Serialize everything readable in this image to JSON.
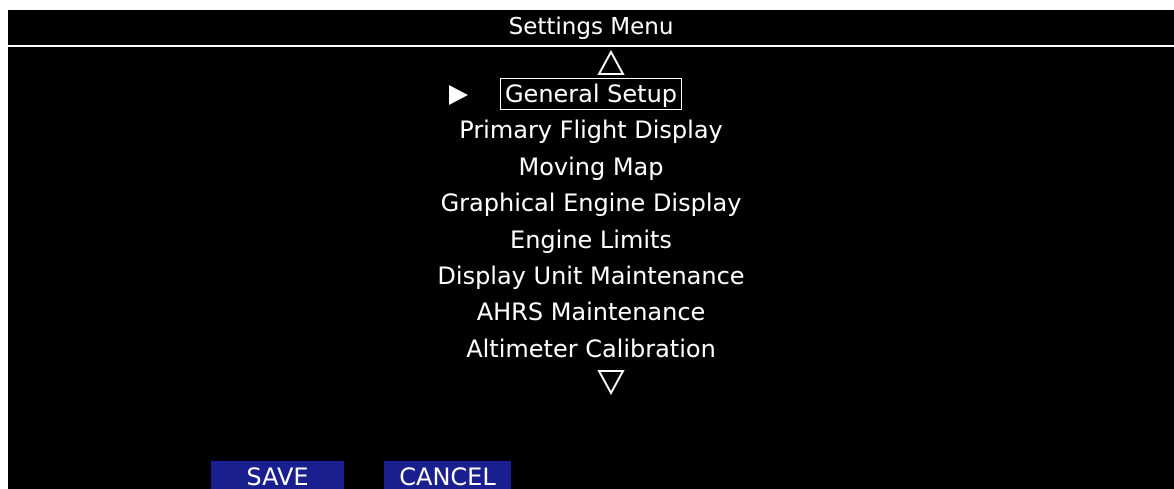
{
  "header": {
    "title": "Settings Menu"
  },
  "menu": {
    "selected_index": 0,
    "items": [
      {
        "label": "General Setup"
      },
      {
        "label": "Primary Flight Display"
      },
      {
        "label": "Moving Map"
      },
      {
        "label": "Graphical Engine Display"
      },
      {
        "label": "Engine Limits"
      },
      {
        "label": "Display Unit Maintenance"
      },
      {
        "label": "AHRS Maintenance"
      },
      {
        "label": "Altimeter Calibration"
      }
    ]
  },
  "icons": {
    "scroll_up": "triangle-up-outline-icon",
    "scroll_down": "triangle-down-outline-icon",
    "selector": "triangle-right-filled-icon"
  },
  "softkeys": {
    "save_label": "SAVE",
    "cancel_label": "CANCEL"
  },
  "colors": {
    "background": "#000000",
    "foreground": "#ffffff",
    "softkey_background": "#1a1f8f"
  }
}
